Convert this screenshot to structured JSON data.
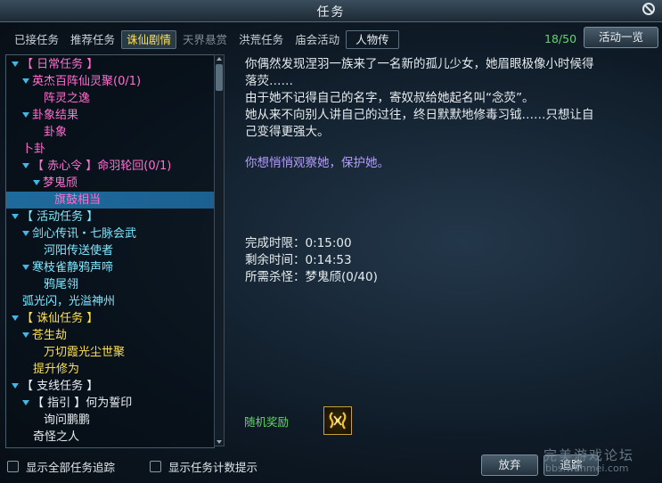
{
  "window": {
    "title": "任务"
  },
  "tabs": [
    {
      "label": "已接任务",
      "state": "normal"
    },
    {
      "label": "推荐任务",
      "state": "normal"
    },
    {
      "label": "诛仙剧情",
      "state": "active"
    },
    {
      "label": "天界悬赏",
      "state": "dim"
    },
    {
      "label": "洪荒任务",
      "state": "normal"
    },
    {
      "label": "庙会活动",
      "state": "normal"
    },
    {
      "label": "人物传",
      "state": "boxed"
    }
  ],
  "quest_count": "18/50",
  "activity_button": "活动一览",
  "tree": [
    {
      "text": "【 日常任务 】",
      "color": "#ff6fd0",
      "expanded": true
    },
    {
      "text": "英杰百阵仙灵聚(0/1)",
      "color": "#ff6fd0",
      "expanded": true
    },
    {
      "text": "阵灵之逸",
      "color": "#ff6fd0",
      "expanded": false
    },
    {
      "text": "卦象结果",
      "color": "#ff6fd0",
      "expanded": true
    },
    {
      "text": "卦象",
      "color": "#ff6fd0",
      "expanded": false
    },
    {
      "text": "卜卦",
      "color": "#ff6fd0",
      "expanded": false
    },
    {
      "text": "【 赤心令 】命羽轮回(0/1)",
      "color": "#ff6fd0",
      "expanded": true
    },
    {
      "text": "梦鬼颀",
      "color": "#ff6fd0",
      "expanded": true
    },
    {
      "text": "旗鼓相当",
      "color": "#ff6fd0",
      "expanded": false,
      "selected": true
    },
    {
      "text": "【 活动任务 】",
      "color": "#7fe8ff",
      "expanded": true
    },
    {
      "text": "剑心传讯・七脉会武",
      "color": "#7fe8ff",
      "expanded": true
    },
    {
      "text": "河阳传送使者",
      "color": "#7fe8ff",
      "expanded": false
    },
    {
      "text": "寒枝雀静鸦声啼",
      "color": "#7fe8ff",
      "expanded": true
    },
    {
      "text": "鸦尾翎",
      "color": "#7fe8ff",
      "expanded": false
    },
    {
      "text": "弧光闪，光溢神州",
      "color": "#7fe8ff",
      "expanded": false
    },
    {
      "text": "【 诛仙任务 】",
      "color": "#ffe04a",
      "expanded": true
    },
    {
      "text": "苍生劫",
      "color": "#ffe04a",
      "expanded": true
    },
    {
      "text": "万切霞光尘世聚",
      "color": "#ffe04a",
      "expanded": false
    },
    {
      "text": "提升修为",
      "color": "#ffe04a",
      "expanded": false
    },
    {
      "text": "【 支线任务 】",
      "color": "#e8eef2",
      "expanded": true
    },
    {
      "text": "【 指引 】何为誓印",
      "color": "#e8eef2",
      "expanded": true
    },
    {
      "text": "询问鹏鹏",
      "color": "#e8eef2",
      "expanded": false
    },
    {
      "text": "奇怪之人",
      "color": "#e8eef2",
      "expanded": false
    }
  ],
  "detail": {
    "desc_lines": [
      "你偶然发现涅羽一族来了一名新的孤儿少女，她眉眼极像小时候得",
      "落荧……",
      "由于她不记得自己的名字，寄奴叔给她起名叫“念荧”。",
      "她从来不向别人讲自己的过往，终日默默地修毒习钺……只想让自",
      "己变得更强大。"
    ],
    "hint": "你想悄悄观察她，保护她。",
    "stats": [
      "完成时限：0:15:00",
      "剩余时间：0:14:53",
      "所需杀怪：梦鬼颀(0/40)"
    ],
    "reward_label": "随机奖励",
    "reward_icon": "golden-rune-icon"
  },
  "footer": {
    "show_all_tracking": "显示全部任务追踪",
    "show_count_hint": "显示任务计数提示",
    "abandon": "放弃",
    "track": "追踪"
  },
  "watermark": {
    "text": "完美游戏论坛",
    "url": "bbs.wanmei.com"
  }
}
